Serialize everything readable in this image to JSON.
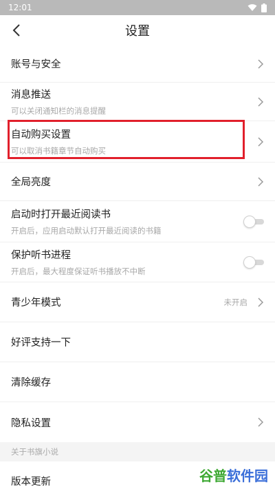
{
  "status_bar": {
    "time": "12:01"
  },
  "header": {
    "title": "设置"
  },
  "settings": {
    "account_security": "账号与安全",
    "push": {
      "label": "消息推送",
      "sub": "可以关闭通知栏的消息提醒"
    },
    "auto_purchase": {
      "label": "自动购买设置",
      "sub": "可以取消书籍章节自动购买"
    },
    "brightness": "全局亮度",
    "open_recent": {
      "label": "启动时打开最近阅读书",
      "sub": "开启后，应用启动默认打开最近阅读的书籍",
      "on": false
    },
    "listen_progress": {
      "label": "保护听书进程",
      "sub": "开启后，最大程度保证听书播放不中断",
      "on": false
    },
    "teen_mode": {
      "label": "青少年模式",
      "value": "未开启"
    },
    "rate": "好评支持一下",
    "clear_cache": "清除缓存",
    "privacy": "隐私设置"
  },
  "about": {
    "header": "关于书旗小说",
    "update": "版本更新"
  },
  "watermark": {
    "part1": "谷普",
    "part2": "软件园"
  },
  "colors": {
    "highlight": "#e11f2b",
    "status_bar": "#b9b9b9"
  }
}
